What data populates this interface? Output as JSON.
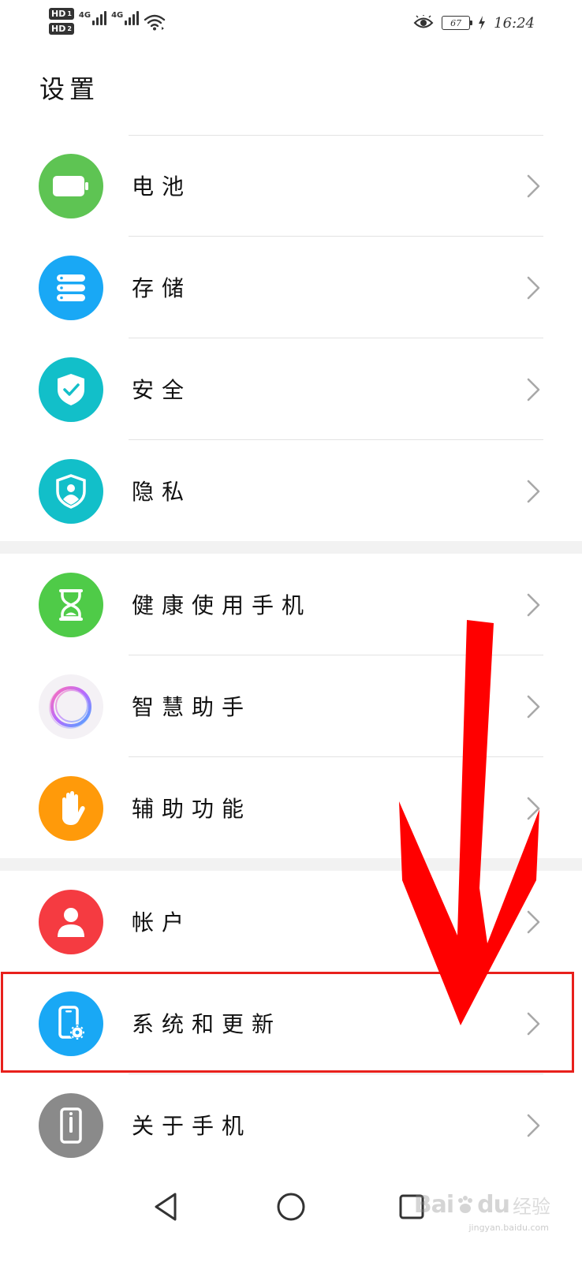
{
  "status_bar": {
    "sim1": "HD",
    "sim1_index": "1",
    "sim2": "HD",
    "sim2_index": "2",
    "network1": "4G",
    "network2": "4G",
    "battery": "67",
    "time": "16:24"
  },
  "page": {
    "title": "设置"
  },
  "groups": [
    {
      "items": [
        {
          "label": "电池",
          "icon": "battery-icon",
          "color": "#5ec453"
        },
        {
          "label": "存储",
          "icon": "storage-icon",
          "color": "#19a8f5"
        },
        {
          "label": "安全",
          "icon": "shield-check-icon",
          "color": "#12bfc9"
        },
        {
          "label": "隐私",
          "icon": "privacy-shield-icon",
          "color": "#12bfc9"
        }
      ]
    },
    {
      "items": [
        {
          "label": "健康使用手机",
          "icon": "hourglass-icon",
          "color": "#4fcb48"
        },
        {
          "label": "智慧助手",
          "icon": "assistant-ring-icon",
          "color": "#f4f1f5"
        },
        {
          "label": "辅助功能",
          "icon": "hand-icon",
          "color": "#ff9a0a"
        }
      ]
    },
    {
      "items": [
        {
          "label": "帐户",
          "icon": "user-icon",
          "color": "#f53b41"
        },
        {
          "label": "系统和更新",
          "icon": "phone-settings-icon",
          "color": "#19a8f5"
        },
        {
          "label": "关于手机",
          "icon": "phone-info-icon",
          "color": "#8a8a8a"
        }
      ]
    }
  ],
  "annotation": {
    "highlight_color": "#e8201c",
    "arrow_color": "#ff0000"
  },
  "watermark": {
    "brand": "Bai",
    "brand_b": "du",
    "suffix": "经验",
    "url": "jingyan.baidu.com"
  }
}
